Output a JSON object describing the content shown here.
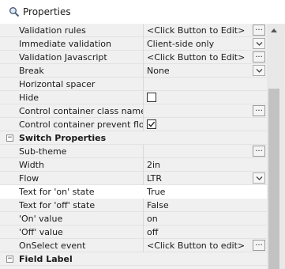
{
  "window": {
    "title": "Properties",
    "icon": "magnifier-icon"
  },
  "rows": [
    {
      "kind": "prop",
      "name": "Validation rules",
      "value": "<Click Button to Edit>",
      "button": "ellipsis"
    },
    {
      "kind": "prop",
      "name": "Immediate validation",
      "value": "Client-side only",
      "button": "dropdown"
    },
    {
      "kind": "prop",
      "name": "Validation Javascript",
      "value": "<Click Button to Edit>",
      "button": "ellipsis"
    },
    {
      "kind": "prop",
      "name": "Break",
      "value": "None",
      "button": "dropdown"
    },
    {
      "kind": "prop",
      "name": "Horizontal spacer",
      "value": ""
    },
    {
      "kind": "prop",
      "name": "Hide",
      "checkbox": false
    },
    {
      "kind": "prop",
      "name": "Control container class name",
      "value": "",
      "button": "ellipsis"
    },
    {
      "kind": "prop",
      "name": "Control container prevent float",
      "checkbox": true
    },
    {
      "kind": "section",
      "name": "Switch Properties",
      "expander": "−"
    },
    {
      "kind": "prop",
      "name": "Sub-theme",
      "value": "",
      "button": "ellipsis"
    },
    {
      "kind": "prop",
      "name": "Width",
      "value": "2in"
    },
    {
      "kind": "prop",
      "name": "Flow",
      "value": "LTR",
      "button": "dropdown"
    },
    {
      "kind": "prop",
      "name": "Text for 'on' state",
      "value": "True",
      "highlight": true
    },
    {
      "kind": "prop",
      "name": "Text for 'off' state",
      "value": "False"
    },
    {
      "kind": "prop",
      "name": "'On' value",
      "value": "on"
    },
    {
      "kind": "prop",
      "name": "'Off' value",
      "value": "off"
    },
    {
      "kind": "prop",
      "name": "OnSelect event",
      "value": "<Click Button to edit>",
      "button": "ellipsis"
    },
    {
      "kind": "section",
      "name": "Field Label",
      "expander": "−"
    }
  ],
  "buttons": {
    "ellipsis_label": "...",
    "dropdown_icon": "chevron-down-icon"
  },
  "colors": {
    "background": "#f0f0f0",
    "highlight": "#ffffff",
    "scroll_thumb": "#c2c2c2"
  }
}
